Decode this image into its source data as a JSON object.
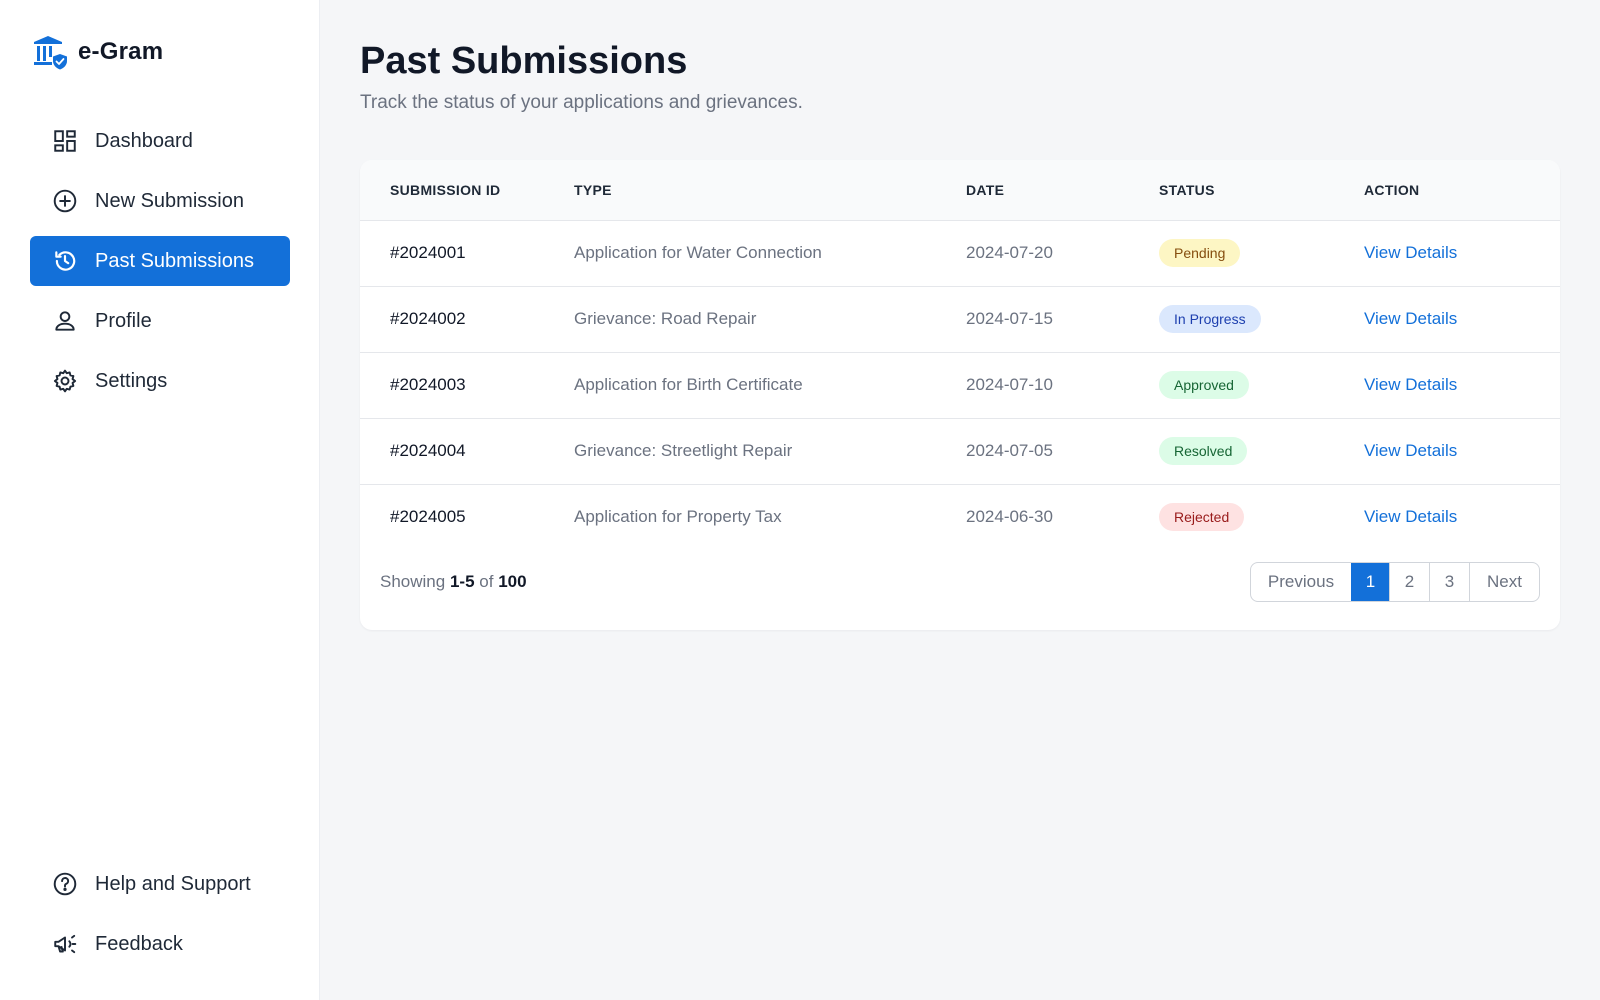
{
  "brand": {
    "name": "e-Gram",
    "icon": "government-building-shield-icon"
  },
  "sidebar": {
    "items": [
      {
        "label": "Dashboard",
        "icon": "dashboard-icon",
        "active": false
      },
      {
        "label": "New Submission",
        "icon": "plus-circle-icon",
        "active": false
      },
      {
        "label": "Past Submissions",
        "icon": "history-icon",
        "active": true
      },
      {
        "label": "Profile",
        "icon": "user-icon",
        "active": false
      },
      {
        "label": "Settings",
        "icon": "gear-icon",
        "active": false
      }
    ],
    "bottom_items": [
      {
        "label": "Help and Support",
        "icon": "help-circle-icon"
      },
      {
        "label": "Feedback",
        "icon": "megaphone-icon"
      }
    ]
  },
  "page": {
    "title": "Past Submissions",
    "subtitle": "Track the status of your applications and grievances."
  },
  "table": {
    "columns": [
      "SUBMISSION ID",
      "TYPE",
      "DATE",
      "STATUS",
      "ACTION"
    ],
    "rows": [
      {
        "id": "#2024001",
        "type": "Application for Water Connection",
        "date": "2024-07-20",
        "status": "Pending",
        "action": "View Details"
      },
      {
        "id": "#2024002",
        "type": "Grievance: Road Repair",
        "date": "2024-07-15",
        "status": "In Progress",
        "action": "View Details"
      },
      {
        "id": "#2024003",
        "type": "Application for Birth Certificate",
        "date": "2024-07-10",
        "status": "Approved",
        "action": "View Details"
      },
      {
        "id": "#2024004",
        "type": "Grievance: Streetlight Repair",
        "date": "2024-07-05",
        "status": "Resolved",
        "action": "View Details"
      },
      {
        "id": "#2024005",
        "type": "Application for Property Tax",
        "date": "2024-06-30",
        "status": "Rejected",
        "action": "View Details"
      }
    ]
  },
  "pagination": {
    "showing_prefix": "Showing",
    "range": "1-5",
    "of_label": "of",
    "total": "100",
    "previous_label": "Previous",
    "pages": [
      "1",
      "2",
      "3"
    ],
    "current_page": "1",
    "next_label": "Next"
  },
  "colors": {
    "accent": "#1370d9",
    "background": "#f5f6f8",
    "status_pending": "#fdf6c4",
    "status_in_progress": "#dbe8fd",
    "status_approved": "#dcfce7",
    "status_rejected": "#fee2e2"
  }
}
